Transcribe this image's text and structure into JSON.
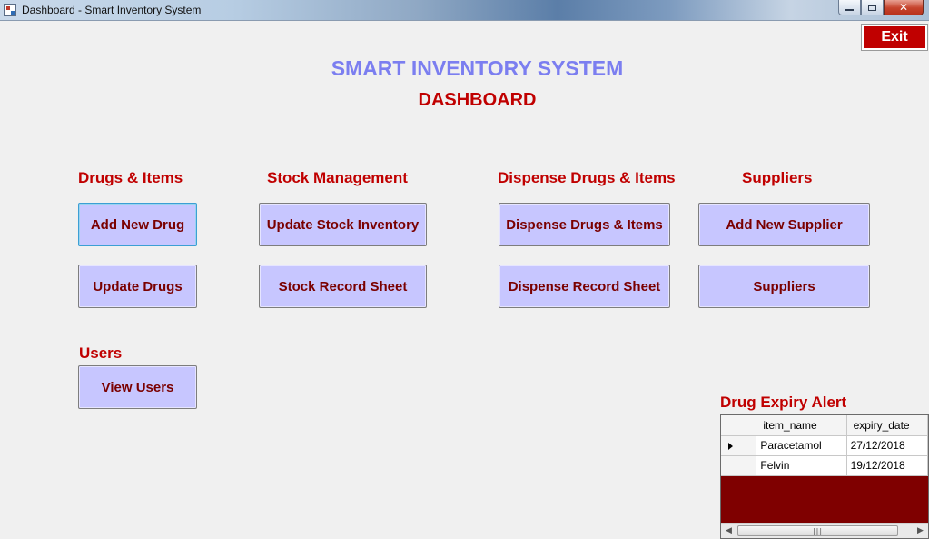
{
  "window": {
    "title": "Dashboard - Smart Inventory System",
    "controls": {
      "minimize": "—",
      "maximize": "",
      "close": "✕"
    }
  },
  "exit_label": "Exit",
  "app_title": "SMART INVENTORY SYSTEM",
  "page_title": "DASHBOARD",
  "sections": {
    "drugs": {
      "label": "Drugs & Items",
      "buttons": [
        "Add New Drug",
        "Update Drugs"
      ]
    },
    "stock": {
      "label": "Stock Management",
      "buttons": [
        "Update Stock Inventory",
        "Stock Record Sheet"
      ]
    },
    "dispense": {
      "label": "Dispense Drugs & Items",
      "buttons": [
        "Dispense Drugs & Items",
        "Dispense Record Sheet"
      ]
    },
    "suppliers": {
      "label": "Suppliers",
      "buttons": [
        "Add New Supplier",
        "Suppliers"
      ]
    },
    "users": {
      "label": "Users",
      "buttons": [
        "View Users"
      ]
    }
  },
  "expiry": {
    "label": "Drug Expiry Alert",
    "columns": [
      "item_name",
      "expiry_date"
    ],
    "rows": [
      [
        "Paracetamol",
        "27/12/2018"
      ],
      [
        "Felvin",
        "19/12/2018"
      ]
    ],
    "scroll_grip": "|||"
  },
  "colors": {
    "accent_red": "#c00000",
    "title_blue": "#7b7ef0",
    "button_fill": "#c7c6ff",
    "button_text": "#7a0000",
    "grid_background": "#7f0000"
  }
}
